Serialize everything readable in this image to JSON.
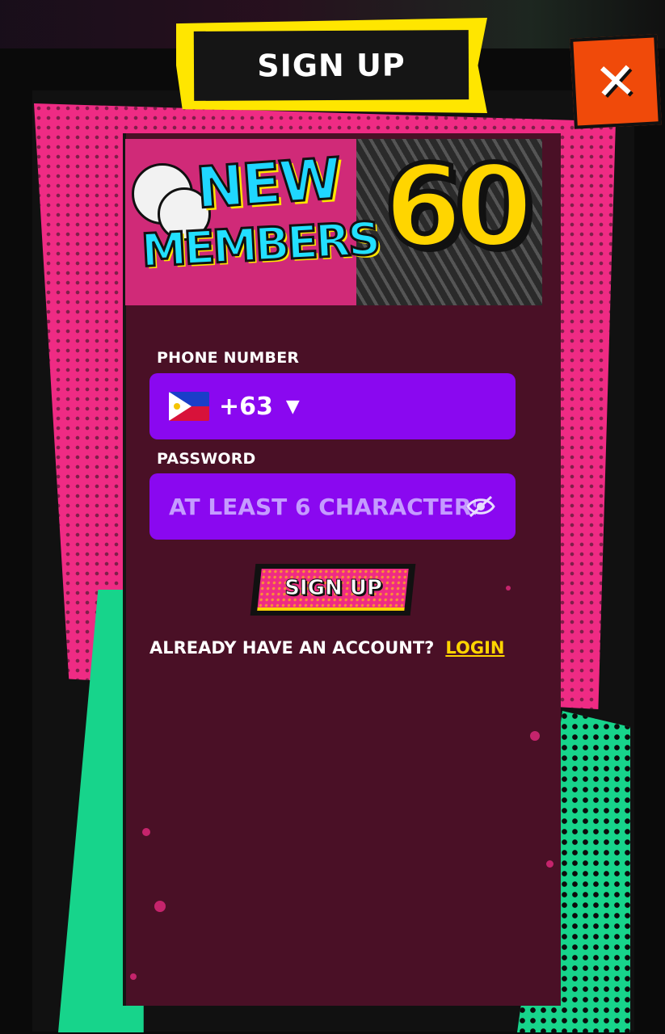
{
  "modal": {
    "title": "SIGN UP",
    "close_icon": "close-icon",
    "close_symbol": "✕"
  },
  "promo": {
    "line1": "NEW",
    "line2": "MEMBERS",
    "amount": "60"
  },
  "form": {
    "phone_label": "PHONE NUMBER",
    "country_code": "+63",
    "country_flag_icon": "philippines-flag-icon",
    "dropdown_symbol": "▼",
    "password_label": "PASSWORD",
    "password_placeholder": "AT LEAST 6 CHARACTERS",
    "password_visibility_icon": "eye-slash-icon",
    "submit_label": "SIGN UP"
  },
  "footer": {
    "prompt": "ALREADY HAVE AN ACCOUNT?",
    "login_link": "LOGIN"
  },
  "colors": {
    "card_bg": "#4a1026",
    "pink": "#ef2b84",
    "green": "#17d48b",
    "field_purple": "#8a08f0",
    "accent_yellow": "#ffd500",
    "close_orange": "#f04a0a"
  }
}
